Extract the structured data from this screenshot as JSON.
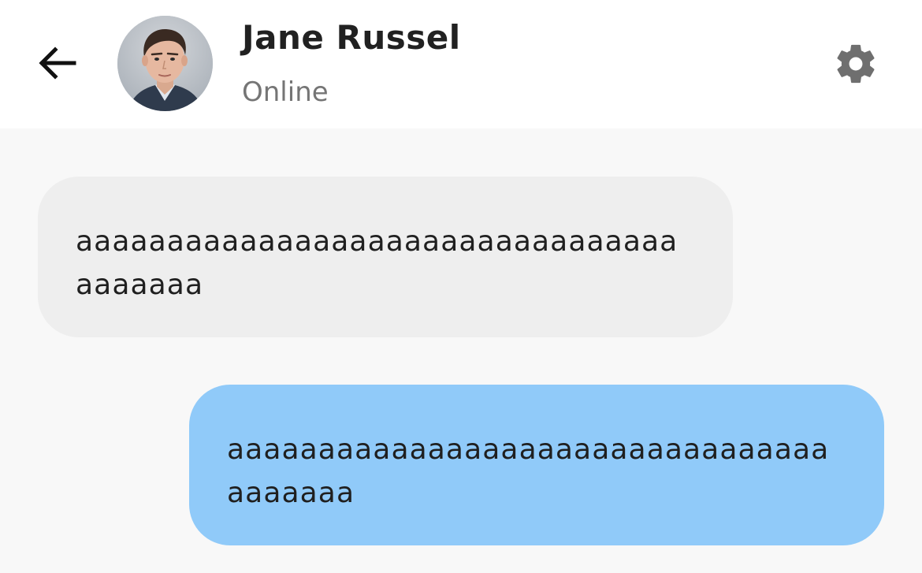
{
  "header": {
    "back_icon": "arrow-back-icon",
    "contact": {
      "name": "Jane Russel",
      "status": "Online",
      "avatar_icon": "user-avatar"
    },
    "settings_icon": "gear-icon"
  },
  "colors": {
    "header_bg": "#ffffff",
    "chat_bg": "#f8f8f8",
    "incoming_bubble": "#eeeeee",
    "outgoing_bubble": "#90caf9",
    "status_text": "#757575",
    "icon_gray": "#6f6f6f"
  },
  "messages": [
    {
      "direction": "incoming",
      "text": "aaaaaaaaaaaaaaaaaaaaaaaaaaaaaaaaaaaaaaaa"
    },
    {
      "direction": "outgoing",
      "text": "aaaaaaaaaaaaaaaaaaaaaaaaaaaaaaaaaaaaaaaa"
    }
  ]
}
